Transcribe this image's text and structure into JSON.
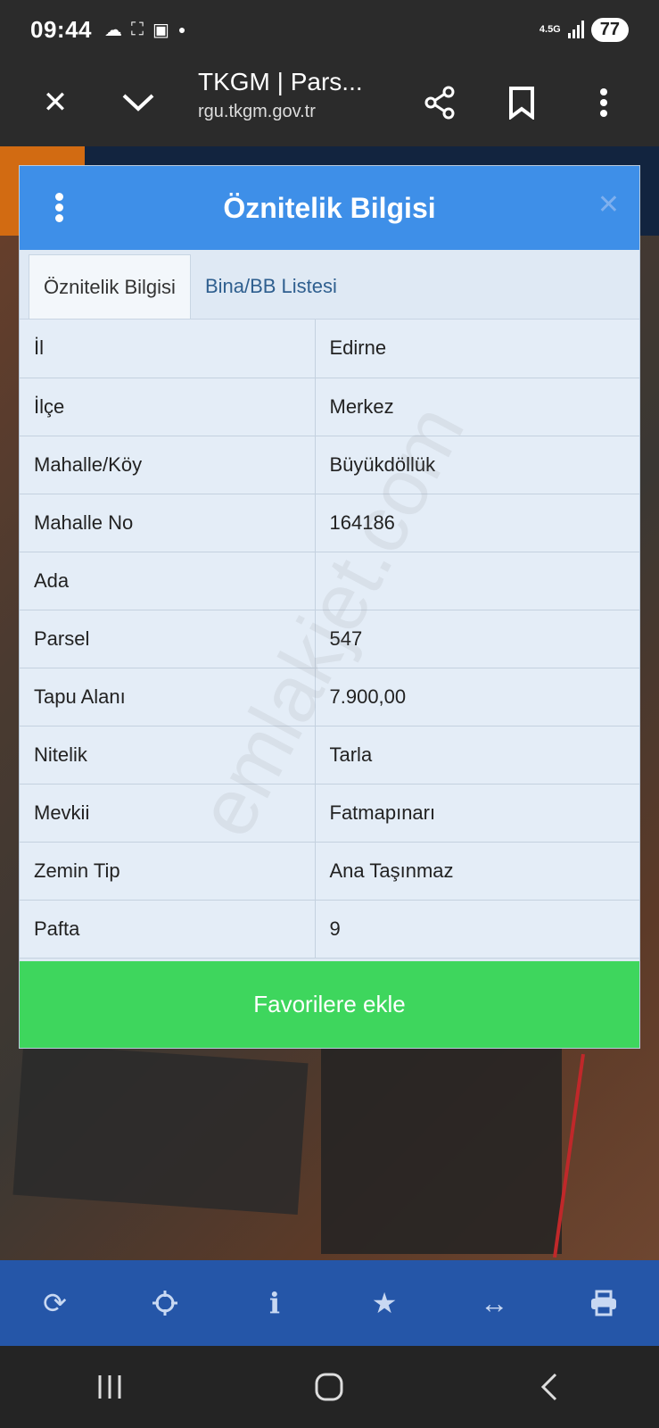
{
  "status_bar": {
    "time": "09:44",
    "network": "4.5G",
    "battery": "77",
    "icons": [
      "cloud-icon",
      "screenshot-icon",
      "package-icon",
      "dot-icon"
    ]
  },
  "browser": {
    "page_title": "TKGM | Pars...",
    "url": "rgu.tkgm.gov.tr"
  },
  "dialog": {
    "title": "Öznitelik Bilgisi",
    "tabs": [
      {
        "label": "Öznitelik Bilgisi",
        "active": true
      },
      {
        "label": "Bina/BB Listesi",
        "active": false
      }
    ],
    "rows": [
      {
        "key": "İl",
        "value": "Edirne"
      },
      {
        "key": "İlçe",
        "value": "Merkez"
      },
      {
        "key": "Mahalle/Köy",
        "value": "Büyükdöllük"
      },
      {
        "key": "Mahalle No",
        "value": "164186"
      },
      {
        "key": "Ada",
        "value": ""
      },
      {
        "key": "Parsel",
        "value": "547"
      },
      {
        "key": "Tapu Alanı",
        "value": "7.900,00"
      },
      {
        "key": "Nitelik",
        "value": "Tarla"
      },
      {
        "key": "Mevkii",
        "value": "Fatmapınarı"
      },
      {
        "key": "Zemin Tip",
        "value": "Ana Taşınmaz"
      },
      {
        "key": "Pafta",
        "value": "9"
      }
    ],
    "favorite_button": "Favorilere ekle"
  },
  "watermark": "emlakjet.com",
  "map_toolbar": [
    "refresh-icon",
    "locate-icon",
    "info-icon",
    "star-icon",
    "measure-icon",
    "print-icon"
  ],
  "colors": {
    "header_blue": "#3e8fe8",
    "favorite_green": "#3ed65d",
    "toolbar_blue": "#2556a8"
  }
}
